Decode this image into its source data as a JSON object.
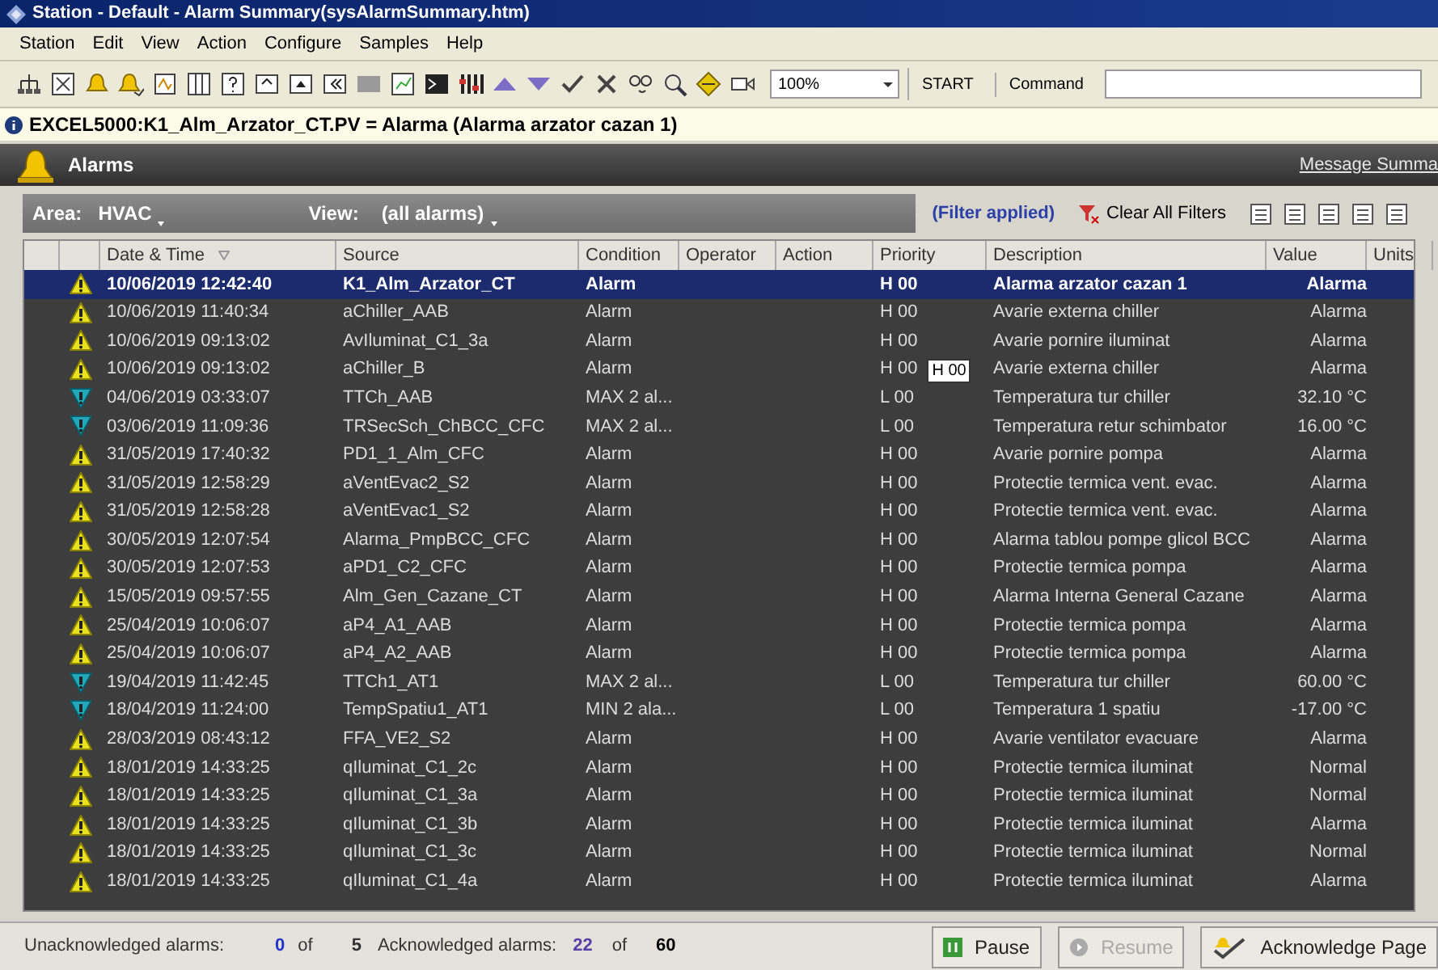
{
  "window": {
    "title": "Station - Default - Alarm Summary(sysAlarmSummary.htm)"
  },
  "menu": [
    {
      "label": "Station"
    },
    {
      "label": "Edit"
    },
    {
      "label": "View"
    },
    {
      "label": "Action"
    },
    {
      "label": "Configure"
    },
    {
      "label": "Samples"
    },
    {
      "label": "Help"
    }
  ],
  "toolbar": {
    "zoom": "100%",
    "start": "START",
    "command_label": "Command"
  },
  "info_bar": {
    "message": "EXCEL5000:K1_Alm_Arzator_CT.PV = Alarma (Alarma arzator cazan 1)"
  },
  "header": {
    "title": "Alarms",
    "link": "Message Summa"
  },
  "filter_bar": {
    "area_label": "Area:",
    "area": "HVAC",
    "view_label": "View:",
    "view": "(all alarms)",
    "filter_status": "(Filter applied)",
    "clear_button": "Clear All Filters"
  },
  "table": {
    "columns": [
      "Date & Time",
      "Source",
      "Condition",
      "Operator",
      "Action",
      "Priority",
      "Description",
      "Value",
      "Units"
    ],
    "rows": [
      {
        "kind": "high",
        "selected": true,
        "date": "10/06/2019 12:42:40",
        "source": "K1_Alm_Arzator_CT",
        "condition": "Alarm",
        "priority": "H 00",
        "description": "Alarma arzator cazan 1",
        "value": "Alarma"
      },
      {
        "kind": "high",
        "selected": false,
        "date": "10/06/2019 11:40:34",
        "source": "aChiller_AAB",
        "condition": "Alarm",
        "priority": "H 00",
        "description": "Avarie externa chiller",
        "value": "Alarma"
      },
      {
        "kind": "high",
        "selected": false,
        "date": "10/06/2019 09:13:02",
        "source": "AvIluminat_C1_3a",
        "condition": "Alarm",
        "priority": "H 00",
        "description": "Avarie pornire iluminat",
        "value": "Alarma"
      },
      {
        "kind": "high",
        "selected": false,
        "date": "10/06/2019 09:13:02",
        "source": "aChiller_B",
        "condition": "Alarm",
        "priority": "H 00",
        "description": "Avarie externa chiller",
        "value": "Alarma",
        "tooltip": "H 00"
      },
      {
        "kind": "low",
        "selected": false,
        "date": "04/06/2019 03:33:07",
        "source": "TTCh_AAB",
        "condition": "MAX 2 al...",
        "priority": "L 00",
        "description": "Temperatura tur chiller",
        "value": "32.10 °C"
      },
      {
        "kind": "low",
        "selected": false,
        "date": "03/06/2019 11:09:36",
        "source": "TRSecSch_ChBCC_CFC",
        "condition": "MAX 2 al...",
        "priority": "L 00",
        "description": "Temperatura retur schimbator",
        "value": "16.00 °C"
      },
      {
        "kind": "high",
        "selected": false,
        "date": "31/05/2019 17:40:32",
        "source": "PD1_1_Alm_CFC",
        "condition": "Alarm",
        "priority": "H 00",
        "description": "Avarie pornire pompa",
        "value": "Alarma"
      },
      {
        "kind": "high",
        "selected": false,
        "date": "31/05/2019 12:58:29",
        "source": "aVentEvac2_S2",
        "condition": "Alarm",
        "priority": "H 00",
        "description": "Protectie termica vent. evac.",
        "value": "Alarma"
      },
      {
        "kind": "high",
        "selected": false,
        "date": "31/05/2019 12:58:28",
        "source": "aVentEvac1_S2",
        "condition": "Alarm",
        "priority": "H 00",
        "description": "Protectie termica vent. evac.",
        "value": "Alarma"
      },
      {
        "kind": "high",
        "selected": false,
        "date": "30/05/2019 12:07:54",
        "source": "Alarma_PmpBCC_CFC",
        "condition": "Alarm",
        "priority": "H 00",
        "description": "Alarma tablou pompe glicol BCC",
        "value": "Alarma"
      },
      {
        "kind": "high",
        "selected": false,
        "date": "30/05/2019 12:07:53",
        "source": "aPD1_C2_CFC",
        "condition": "Alarm",
        "priority": "H 00",
        "description": "Protectie termica pompa",
        "value": "Alarma"
      },
      {
        "kind": "high",
        "selected": false,
        "date": "15/05/2019 09:57:55",
        "source": "Alm_Gen_Cazane_CT",
        "condition": "Alarm",
        "priority": "H 00",
        "description": "Alarma Interna General Cazane",
        "value": "Alarma"
      },
      {
        "kind": "high",
        "selected": false,
        "date": "25/04/2019 10:06:07",
        "source": "aP4_A1_AAB",
        "condition": "Alarm",
        "priority": "H 00",
        "description": "Protectie termica pompa",
        "value": "Alarma"
      },
      {
        "kind": "high",
        "selected": false,
        "date": "25/04/2019 10:06:07",
        "source": "aP4_A2_AAB",
        "condition": "Alarm",
        "priority": "H 00",
        "description": "Protectie termica pompa",
        "value": "Alarma"
      },
      {
        "kind": "low",
        "selected": false,
        "date": "19/04/2019 11:42:45",
        "source": "TTCh1_AT1",
        "condition": "MAX 2 al...",
        "priority": "L 00",
        "description": "Temperatura tur chiller",
        "value": "60.00 °C"
      },
      {
        "kind": "low",
        "selected": false,
        "date": "18/04/2019 11:24:00",
        "source": "TempSpatiu1_AT1",
        "condition": "MIN 2 ala...",
        "priority": "L 00",
        "description": "Temperatura 1 spatiu",
        "value": "-17.00 °C"
      },
      {
        "kind": "high",
        "selected": false,
        "date": "28/03/2019 08:43:12",
        "source": "FFA_VE2_S2",
        "condition": "Alarm",
        "priority": "H 00",
        "description": "Avarie ventilator evacuare",
        "value": "Alarma"
      },
      {
        "kind": "high",
        "selected": false,
        "date": "18/01/2019 14:33:25",
        "source": "qIluminat_C1_2c",
        "condition": "Alarm",
        "priority": "H 00",
        "description": "Protectie termica iluminat",
        "value": "Normal"
      },
      {
        "kind": "high",
        "selected": false,
        "date": "18/01/2019 14:33:25",
        "source": "qIluminat_C1_3a",
        "condition": "Alarm",
        "priority": "H 00",
        "description": "Protectie termica iluminat",
        "value": "Normal"
      },
      {
        "kind": "high",
        "selected": false,
        "date": "18/01/2019 14:33:25",
        "source": "qIluminat_C1_3b",
        "condition": "Alarm",
        "priority": "H 00",
        "description": "Protectie termica iluminat",
        "value": "Alarma"
      },
      {
        "kind": "high",
        "selected": false,
        "date": "18/01/2019 14:33:25",
        "source": "qIluminat_C1_3c",
        "condition": "Alarm",
        "priority": "H 00",
        "description": "Protectie termica iluminat",
        "value": "Normal"
      },
      {
        "kind": "high",
        "selected": false,
        "date": "18/01/2019 14:33:25",
        "source": "qIluminat_C1_4a",
        "condition": "Alarm",
        "priority": "H 00",
        "description": "Protectie termica iluminat",
        "value": "Alarma"
      }
    ]
  },
  "status_bar": {
    "unack_label": "Unacknowledged alarms:",
    "unack_count": "0",
    "unack_of": "of",
    "unack_total": "5",
    "ack_label": "Acknowledged alarms:",
    "ack_count": "22",
    "ack_of": "of",
    "ack_total": "60",
    "buttons": [
      {
        "kind": "pause",
        "label": "Pause",
        "disabled": false
      },
      {
        "kind": "resume",
        "label": "Resume",
        "disabled": true
      },
      {
        "kind": "ack",
        "label": "Acknowledge Page",
        "disabled": false
      }
    ]
  }
}
